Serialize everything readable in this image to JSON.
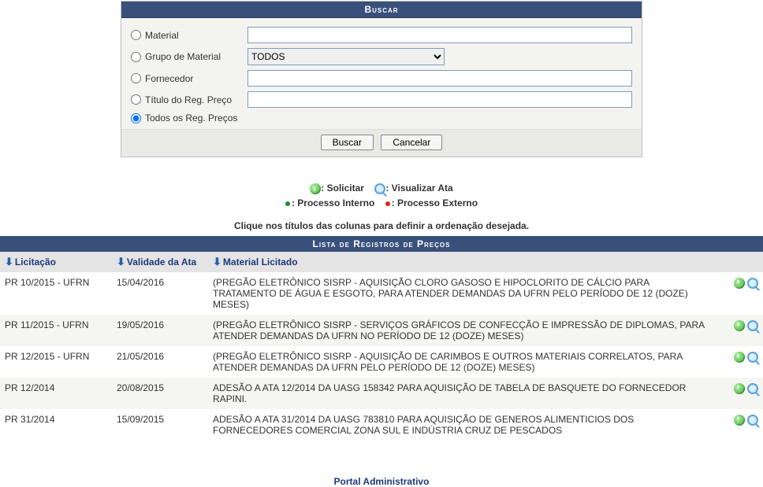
{
  "search": {
    "title": "Buscar",
    "options": {
      "material": "Material",
      "grupo": "Grupo de Material",
      "fornecedor": "Fornecedor",
      "titulo": "Título do Reg. Preço",
      "todos": "Todos os Reg. Preços"
    },
    "grupo_selected": "TODOS",
    "buttons": {
      "buscar": "Buscar",
      "cancelar": "Cancelar"
    }
  },
  "legend": {
    "solicitar": ": Solicitar",
    "visualizar": ": Visualizar Ata",
    "interno": ": Processo Interno",
    "externo": ": Processo Externo"
  },
  "instruction": "Clique nos títulos das colunas para definir a ordenação desejada.",
  "list": {
    "title": "Lista de Registros de Preços",
    "columns": {
      "licitacao": "Licitação",
      "validade": "Validade da Ata",
      "material": "Material Licitado"
    },
    "rows": [
      {
        "licitacao": "PR 10/2015 - UFRN",
        "validade": "15/04/2016",
        "material": "(PREGÃO ELETRÔNICO SISRP - AQUISIÇÃO CLORO GASOSO E HIPOCLORITO DE CÁLCIO PARA TRATAMENTO DE ÁGUA E ESGOTO, PARA ATENDER DEMANDAS DA UFRN PELO PERÍODO DE 12 (DOZE) MESES)"
      },
      {
        "licitacao": "PR 11/2015 - UFRN",
        "validade": "19/05/2016",
        "material": "(PREGÃO ELETRÔNICO SISRP - SERVIÇOS GRÁFICOS DE CONFECÇÃO E IMPRESSÃO DE DIPLOMAS, PARA ATENDER DEMANDAS DA UFRN NO PERÍODO DE 12 (DOZE) MESES)"
      },
      {
        "licitacao": "PR 12/2015 - UFRN",
        "validade": "21/05/2016",
        "material": "(PREGÃO ELETRÔNICO SISRP - AQUISIÇÃO DE CARIMBOS E OUTROS MATERIAIS CORRELATOS, PARA ATENDER DEMANDAS DA UFRN PELO PERÍODO DE 12 (DOZE) MESES)"
      },
      {
        "licitacao": "PR 12/2014",
        "validade": "20/08/2015",
        "material": "ADESÃO A ATA 12/2014 DA UASG 158342 PARA AQUISIÇÃO DE TABELA DE BASQUETE DO FORNECEDOR RAPINI."
      },
      {
        "licitacao": "PR 31/2014",
        "validade": "15/09/2015",
        "material": "ADESÃO A ATA 31/2014 DA UASG 783810 PARA AQUISIÇÃO DE GENEROS ALIMENTICIOS DOS FORNECEDORES COMERCIAL ZONA SUL E INDÚSTRIA CRUZ DE PESCADOS"
      }
    ]
  },
  "footer": "Portal Administrativo"
}
